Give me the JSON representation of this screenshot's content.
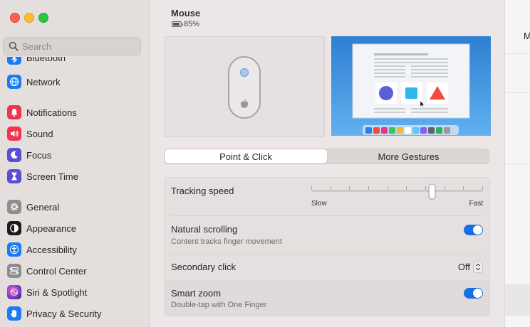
{
  "window_controls": {
    "close": "close",
    "minimize": "minimize",
    "zoom": "zoom"
  },
  "search": {
    "placeholder": "Search"
  },
  "sidebar": {
    "cut_item": {
      "label": "Bluetooth",
      "icon": "bluetooth-icon",
      "color": "#1a7cf5"
    },
    "items": [
      {
        "label": "Network",
        "icon": "globe-icon",
        "color": "#1a7cf5"
      },
      {
        "label": "Notifications",
        "icon": "bell-icon",
        "color": "#f2334a"
      },
      {
        "label": "Sound",
        "icon": "speaker-icon",
        "color": "#f2334a"
      },
      {
        "label": "Focus",
        "icon": "moon-icon",
        "color": "#5b4cd6"
      },
      {
        "label": "Screen Time",
        "icon": "hourglass-icon",
        "color": "#5b4cd6"
      },
      {
        "label": "General",
        "icon": "gear-icon",
        "color": "#8c8c91"
      },
      {
        "label": "Appearance",
        "icon": "appearance-icon",
        "color": "#1c1c1e"
      },
      {
        "label": "Accessibility",
        "icon": "accessibility-icon",
        "color": "#1a7cf5"
      },
      {
        "label": "Control Center",
        "icon": "control-center-icon",
        "color": "#8c8c91"
      },
      {
        "label": "Siri & Spotlight",
        "icon": "siri-icon",
        "color": "#b03cc8"
      },
      {
        "label": "Privacy & Security",
        "icon": "hand-icon",
        "color": "#1a7cf5"
      }
    ]
  },
  "header": {
    "title": "Mouse",
    "battery": "85%",
    "battery_level": 0.85
  },
  "tabs": [
    {
      "label": "Point & Click",
      "selected": true
    },
    {
      "label": "More Gestures",
      "selected": false
    }
  ],
  "settings": {
    "tracking": {
      "label": "Tracking speed",
      "min_label": "Slow",
      "max_label": "Fast",
      "value_fraction": 0.7
    },
    "natural_scrolling": {
      "label": "Natural scrolling",
      "sublabel": "Content tracks finger movement",
      "on": true
    },
    "secondary_click": {
      "label": "Secondary click",
      "value": "Off"
    },
    "smart_zoom": {
      "label": "Smart zoom",
      "sublabel": "Double-tap with One Finger",
      "on": true
    }
  },
  "right_panel": {
    "letter": "M"
  },
  "colors": {
    "accent": "#1670e0",
    "sidebar_bg": "#e4dedd",
    "main_bg": "#ece7e6"
  }
}
